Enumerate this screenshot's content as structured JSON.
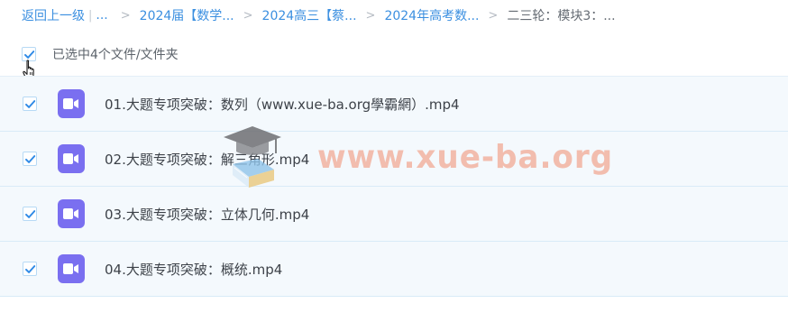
{
  "breadcrumb": {
    "back_label": "返回上一级",
    "separator_bar": "|",
    "ellipsis": "...",
    "items": [
      {
        "label": "2024届【数学..."
      },
      {
        "label": "2024高三【蔡..."
      },
      {
        "label": "2024年高考数..."
      }
    ],
    "current": "二三轮：模块3：...",
    "separator": ">"
  },
  "selection": {
    "label": "已选中4个文件/文件夹",
    "checked": true
  },
  "files": [
    {
      "name": "01.大题专项突破：数列（www.xue-ba.org學霸網）.mp4",
      "type": "video",
      "checked": true
    },
    {
      "name": "02.大题专项突破：解三角形.mp4",
      "type": "video",
      "checked": true
    },
    {
      "name": "03.大题专项突破：立体几何.mp4",
      "type": "video",
      "checked": true
    },
    {
      "name": "04.大题专项突破：概统.mp4",
      "type": "video",
      "checked": true
    }
  ],
  "watermark": {
    "text": "www.xue-ba.org"
  },
  "colors": {
    "accent": "#3b8fe0",
    "video_icon": "#7a6ff0",
    "row_bg": "#f4f9fd",
    "watermark": "#f08c6e"
  },
  "icons": {
    "checkbox": "checkmark-icon",
    "file": "video-file-icon",
    "cursor": "hand-pointer-icon",
    "watermark_logo": "graduation-cap-icon"
  }
}
